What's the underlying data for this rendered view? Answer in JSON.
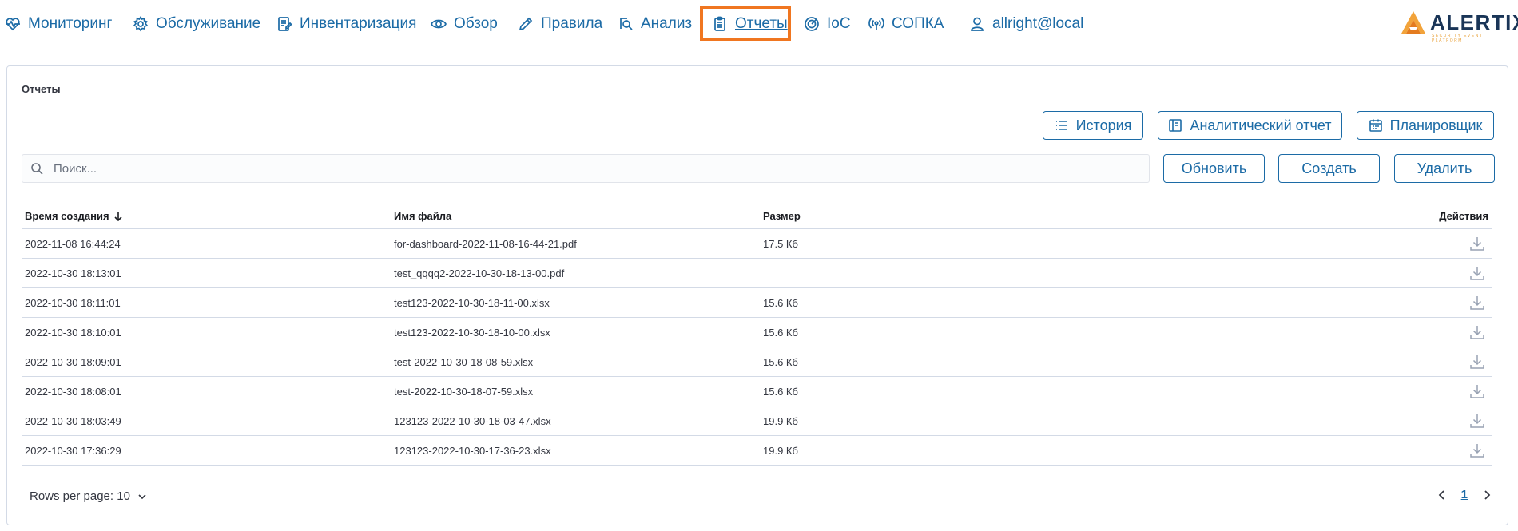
{
  "nav": {
    "items": [
      {
        "label": "Мониторинг",
        "icon": "heart-pulse-icon"
      },
      {
        "label": "Обслуживание",
        "icon": "gear-icon"
      },
      {
        "label": "Инвентаризация",
        "icon": "inventory-icon"
      },
      {
        "label": "Обзор",
        "icon": "eye-icon"
      },
      {
        "label": "Правила",
        "icon": "pencil-icon"
      },
      {
        "label": "Анализ",
        "icon": "search-doc-icon"
      },
      {
        "label": "Отчеты",
        "icon": "clipboard-icon",
        "active": true
      },
      {
        "label": "IoC",
        "icon": "radar-icon"
      },
      {
        "label": "СОПКА",
        "icon": "broadcast-icon"
      },
      {
        "label": "allright@local",
        "icon": "user-icon"
      }
    ],
    "accent_color": "#1c6ba6",
    "active_highlight_color": "#f07620"
  },
  "logo": {
    "text": "ALERTIX",
    "tagline": "SECURITY EVENT PLATFORM"
  },
  "panel": {
    "title": "Отчеты"
  },
  "toolbar": {
    "history_label": "История",
    "analytic_report_label": "Аналитический отчет",
    "scheduler_label": "Планировщик",
    "refresh_label": "Обновить",
    "create_label": "Создать",
    "delete_label": "Удалить"
  },
  "search": {
    "placeholder": "Поиск...",
    "value": ""
  },
  "table": {
    "columns": {
      "created": "Время создания",
      "filename": "Имя файла",
      "size": "Размер",
      "actions": "Действия"
    },
    "sort": {
      "column": "created",
      "direction": "desc"
    },
    "rows": [
      {
        "created": "2022-11-08 16:44:24",
        "filename": "for-dashboard-2022-11-08-16-44-21.pdf",
        "size": "17.5 Кб"
      },
      {
        "created": "2022-10-30 18:13:01",
        "filename": "test_qqqq2-2022-10-30-18-13-00.pdf",
        "size": ""
      },
      {
        "created": "2022-10-30 18:11:01",
        "filename": "test123-2022-10-30-18-11-00.xlsx",
        "size": "15.6 Кб"
      },
      {
        "created": "2022-10-30 18:10:01",
        "filename": "test123-2022-10-30-18-10-00.xlsx",
        "size": "15.6 Кб"
      },
      {
        "created": "2022-10-30 18:09:01",
        "filename": "test-2022-10-30-18-08-59.xlsx",
        "size": "15.6 Кб"
      },
      {
        "created": "2022-10-30 18:08:01",
        "filename": "test-2022-10-30-18-07-59.xlsx",
        "size": "15.6 Кб"
      },
      {
        "created": "2022-10-30 18:03:49",
        "filename": "123123-2022-10-30-18-03-47.xlsx",
        "size": "19.9 Кб"
      },
      {
        "created": "2022-10-30 17:36:29",
        "filename": "123123-2022-10-30-17-36-23.xlsx",
        "size": "19.9 Кб"
      }
    ]
  },
  "pagination": {
    "rows_per_page_label": "Rows per page: 10",
    "current_page": "1"
  }
}
